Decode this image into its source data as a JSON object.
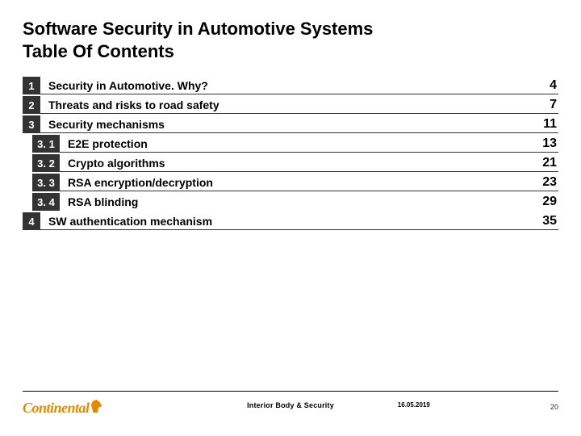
{
  "title_line1": "Software Security in Automotive Systems",
  "title_line2": "Table Of Contents",
  "toc": [
    {
      "num": "1",
      "label": "Security in Automotive. Why?",
      "page": "4",
      "sub": false
    },
    {
      "num": "2",
      "label": "Threats and risks to road safety",
      "page": "7",
      "sub": false
    },
    {
      "num": "3",
      "label": "Security mechanisms",
      "page": "11",
      "sub": false
    },
    {
      "num": "3. 1",
      "label": "E2E protection",
      "page": "13",
      "sub": true
    },
    {
      "num": "3. 2",
      "label": "Crypto algorithms",
      "page": "21",
      "sub": true
    },
    {
      "num": "3. 3",
      "label": "RSA encryption/decryption",
      "page": "23",
      "sub": true
    },
    {
      "num": "3. 4",
      "label": "RSA blinding",
      "page": "29",
      "sub": true
    },
    {
      "num": "4",
      "label": "SW authentication mechanism",
      "page": "35",
      "sub": false
    }
  ],
  "footer": {
    "logo_text": "Continental",
    "center": "Interior Body & Security",
    "date": "16.05.2019",
    "page": "20"
  }
}
